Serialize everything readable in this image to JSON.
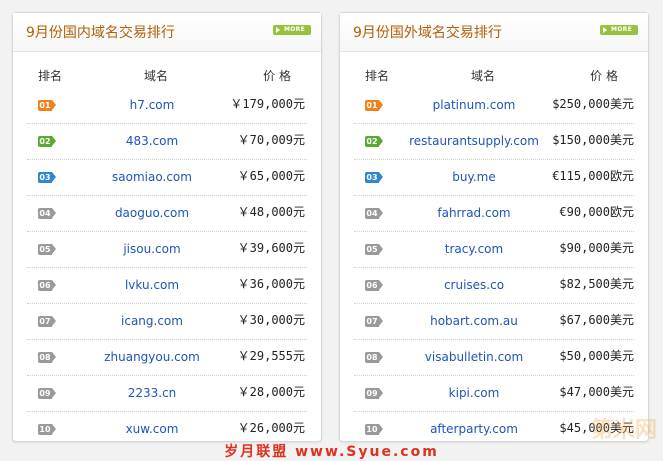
{
  "panels": {
    "left": {
      "title": "9月份国内域名交易排行",
      "more": "MORE",
      "headers": {
        "rank": "排名",
        "domain": "域名",
        "price": "价 格"
      },
      "rows": [
        {
          "rank": "01",
          "domain": "h7.com",
          "price": "￥179,000元"
        },
        {
          "rank": "02",
          "domain": "483.com",
          "price": "￥70,009元"
        },
        {
          "rank": "03",
          "domain": "saomiao.com",
          "price": "￥65,000元"
        },
        {
          "rank": "04",
          "domain": "daoguo.com",
          "price": "￥48,000元"
        },
        {
          "rank": "05",
          "domain": "jisou.com",
          "price": "￥39,600元"
        },
        {
          "rank": "06",
          "domain": "lvku.com",
          "price": "￥36,000元"
        },
        {
          "rank": "07",
          "domain": "icang.com",
          "price": "￥30,000元"
        },
        {
          "rank": "08",
          "domain": "zhuangyou.com",
          "price": "￥29,555元"
        },
        {
          "rank": "09",
          "domain": "2233.cn",
          "price": "￥28,000元"
        },
        {
          "rank": "10",
          "domain": "xuw.com",
          "price": "￥26,000元"
        }
      ]
    },
    "right": {
      "title": "9月份国外域名交易排行",
      "more": "MORE",
      "headers": {
        "rank": "排名",
        "domain": "域名",
        "price": "价 格"
      },
      "rows": [
        {
          "rank": "01",
          "domain": "platinum.com",
          "price": "$250,000美元"
        },
        {
          "rank": "02",
          "domain": "restaurantsupply.com",
          "price": "$150,000美元"
        },
        {
          "rank": "03",
          "domain": "buy.me",
          "price": "€115,000欧元"
        },
        {
          "rank": "04",
          "domain": "fahrrad.com",
          "price": "€90,000欧元"
        },
        {
          "rank": "05",
          "domain": "tracy.com",
          "price": "$90,000美元"
        },
        {
          "rank": "06",
          "domain": "cruises.co",
          "price": "$82,500美元"
        },
        {
          "rank": "07",
          "domain": "hobart.com.au",
          "price": "$67,600美元"
        },
        {
          "rank": "08",
          "domain": "visabulletin.com",
          "price": "$50,000美元"
        },
        {
          "rank": "09",
          "domain": "kipi.com",
          "price": "$47,000美元"
        },
        {
          "rank": "10",
          "domain": "afterparty.com",
          "price": "$45,000美元"
        }
      ]
    }
  },
  "footer": {
    "text": "岁月联盟 www.Syue.com"
  },
  "watermark": {
    "text": "第米网"
  },
  "colors": {
    "title": "#b25f08",
    "link": "#1e55b8",
    "rank1": "#f2811d",
    "rank2": "#5aaa32",
    "rank3": "#2e86d1",
    "rank_other": "#9a9a9a",
    "more_button": "#97c33c",
    "footer": "#e0301e"
  }
}
